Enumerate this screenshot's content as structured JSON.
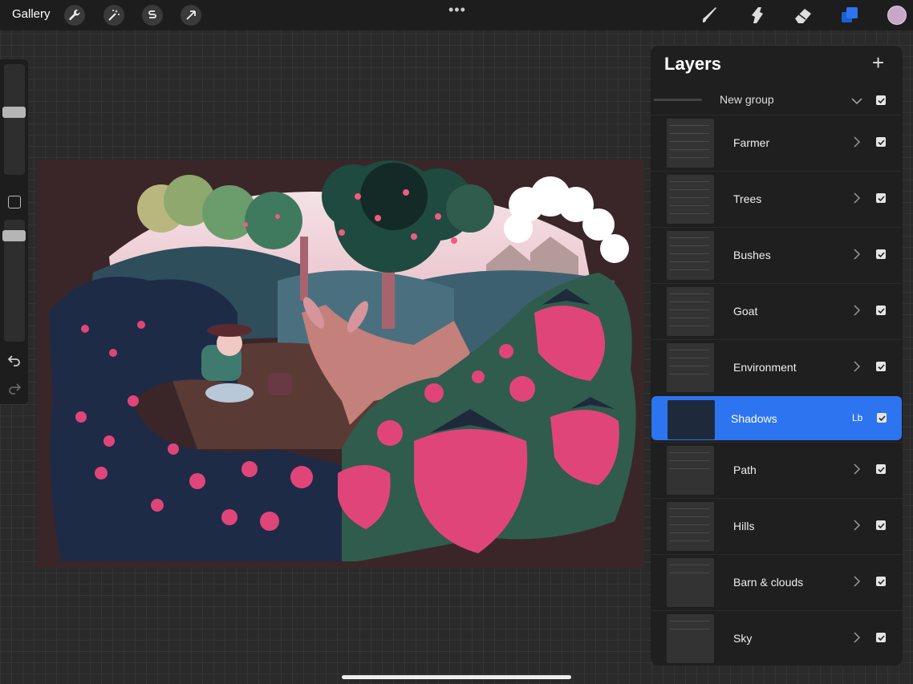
{
  "topbar": {
    "gallery_label": "Gallery",
    "tools": [
      "wrench-icon",
      "magic-wand-icon",
      "selection-s-icon",
      "arrow-cursor-icon"
    ],
    "more_label": "•••",
    "right_tools": [
      "brush-icon",
      "smudge-icon",
      "eraser-icon",
      "layers-icon"
    ],
    "current_color": "#c8a8c8"
  },
  "layers_panel": {
    "title": "Layers",
    "add_label": "+",
    "group": {
      "label": "New group",
      "visible": true
    },
    "layers": [
      {
        "name": "Farmer",
        "visible": true
      },
      {
        "name": "Trees",
        "visible": true
      },
      {
        "name": "Bushes",
        "visible": true
      },
      {
        "name": "Goat",
        "visible": true
      },
      {
        "name": "Environment",
        "visible": true
      },
      {
        "name": "Shadows",
        "visible": true,
        "selected": true,
        "blend_mode": "Lb"
      },
      {
        "name": "Path",
        "visible": true
      },
      {
        "name": "Hills",
        "visible": true
      },
      {
        "name": "Barn & clouds",
        "visible": true
      },
      {
        "name": "Sky",
        "visible": true
      }
    ]
  },
  "colors": {
    "accent": "#2d74f0",
    "canvas_bg": "#3a2628",
    "strawberry": "#e0457a"
  }
}
